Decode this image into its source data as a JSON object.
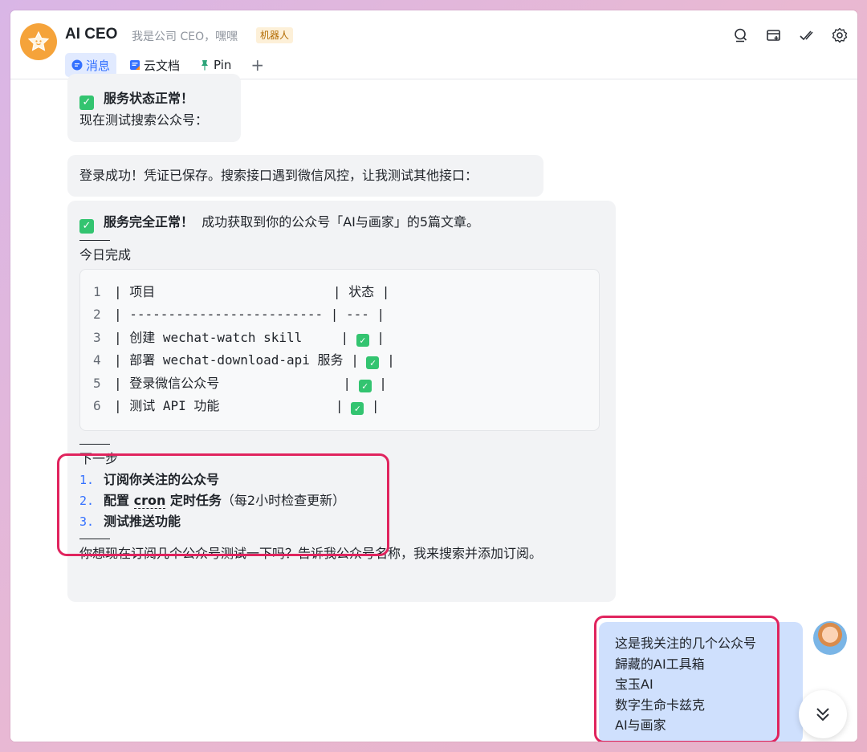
{
  "header": {
    "title": "AI CEO",
    "subtitle": "我是公司 CEO，嘿嘿",
    "badge": "机器人",
    "tabs": [
      {
        "label": "消息",
        "icon": "message-icon",
        "active": true
      },
      {
        "label": "云文档",
        "icon": "doc-icon",
        "active": false
      },
      {
        "label": "Pin",
        "icon": "pin-icon",
        "active": false
      }
    ],
    "add_tab": "+",
    "icons": [
      "search-icon",
      "add-chat-icon",
      "done-icon",
      "settings-icon"
    ]
  },
  "messages": {
    "m1": {
      "status_bold": "服务状态正常！",
      "line2": "现在测试搜索公众号："
    },
    "m2": {
      "text": "登录成功！凭证已保存。搜索接口遇到微信风控，让我测试其他接口："
    },
    "m3": {
      "status_bold": "服务完全正常！",
      "status_rest": "成功获取到你的公众号「AI与画家」的5篇文章。",
      "today_title": "今日完成",
      "code_lines": [
        {
          "n": "1",
          "pre": "| 项目                       | 状态 |",
          "check": false
        },
        {
          "n": "2",
          "pre": "| ------------------------- | --- |",
          "check": false
        },
        {
          "n": "3",
          "pre": "| 创建 wechat-watch skill     | ",
          "check": true,
          "post": " |"
        },
        {
          "n": "4",
          "pre": "| 部署 wechat-download-api 服务 | ",
          "check": true,
          "post": " |"
        },
        {
          "n": "5",
          "pre": "| 登录微信公众号                | ",
          "check": true,
          "post": " |"
        },
        {
          "n": "6",
          "pre": "| 测试 API 功能               | ",
          "check": true,
          "post": " |"
        }
      ],
      "next_title": "下一步",
      "steps": [
        {
          "num": "1.",
          "bold": "订阅你关注的公众号",
          "rest": ""
        },
        {
          "num": "2.",
          "bold_pre": "配置 ",
          "bold_cron": "cron",
          "bold_post": " 定时任务",
          "rest": "（每2小时检查更新）"
        },
        {
          "num": "3.",
          "bold": "测试推送功能",
          "rest": ""
        }
      ],
      "question": "你想现在订阅几个公众号测试一下吗？告诉我公众号名称，我来搜索并添加订阅。"
    },
    "user": {
      "lines": [
        "这是我关注的几个公众号",
        "歸藏的AI工具箱",
        "宝玉AI",
        "数字生命卡兹克",
        "AI与画家"
      ]
    }
  },
  "colors": {
    "accent": "#3370ff",
    "check": "#33c470",
    "highlight": "#e0245e",
    "user_bubble": "#cfe0fd"
  }
}
